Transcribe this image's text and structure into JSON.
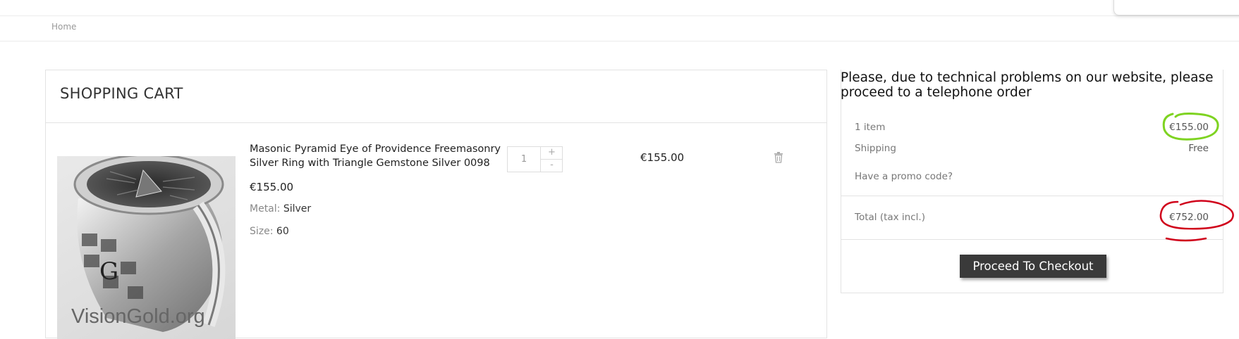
{
  "breadcrumb": {
    "home_label": "Home"
  },
  "cart": {
    "title": "SHOPPING CART",
    "item": {
      "name": "Masonic Pyramid Eye of Providence Freemasonry Silver Ring with Triangle Gemstone Silver 0098",
      "unit_price": "€155.00",
      "attributes": [
        {
          "label": "Metal:",
          "value": "Silver"
        },
        {
          "label": "Size:",
          "value": "60"
        }
      ],
      "quantity": "1",
      "qty_up": "+",
      "qty_down": "-",
      "line_total": "€155.00",
      "image_watermark": "VisionGold.org"
    }
  },
  "summary": {
    "notice": "Please, due to technical problems on our website, please proceed to a telephone order",
    "items_label": "1 item",
    "items_value": "€155.00",
    "shipping_label": "Shipping",
    "shipping_value": "Free",
    "promo_label": "Have a promo code?",
    "total_label": "Total (tax incl.)",
    "total_value": "€752.00",
    "checkout_label": "Proceed To Checkout"
  },
  "colors": {
    "button_bg": "#3a3a3a",
    "annotation_green": "#7ed321",
    "annotation_red": "#d0021b"
  }
}
